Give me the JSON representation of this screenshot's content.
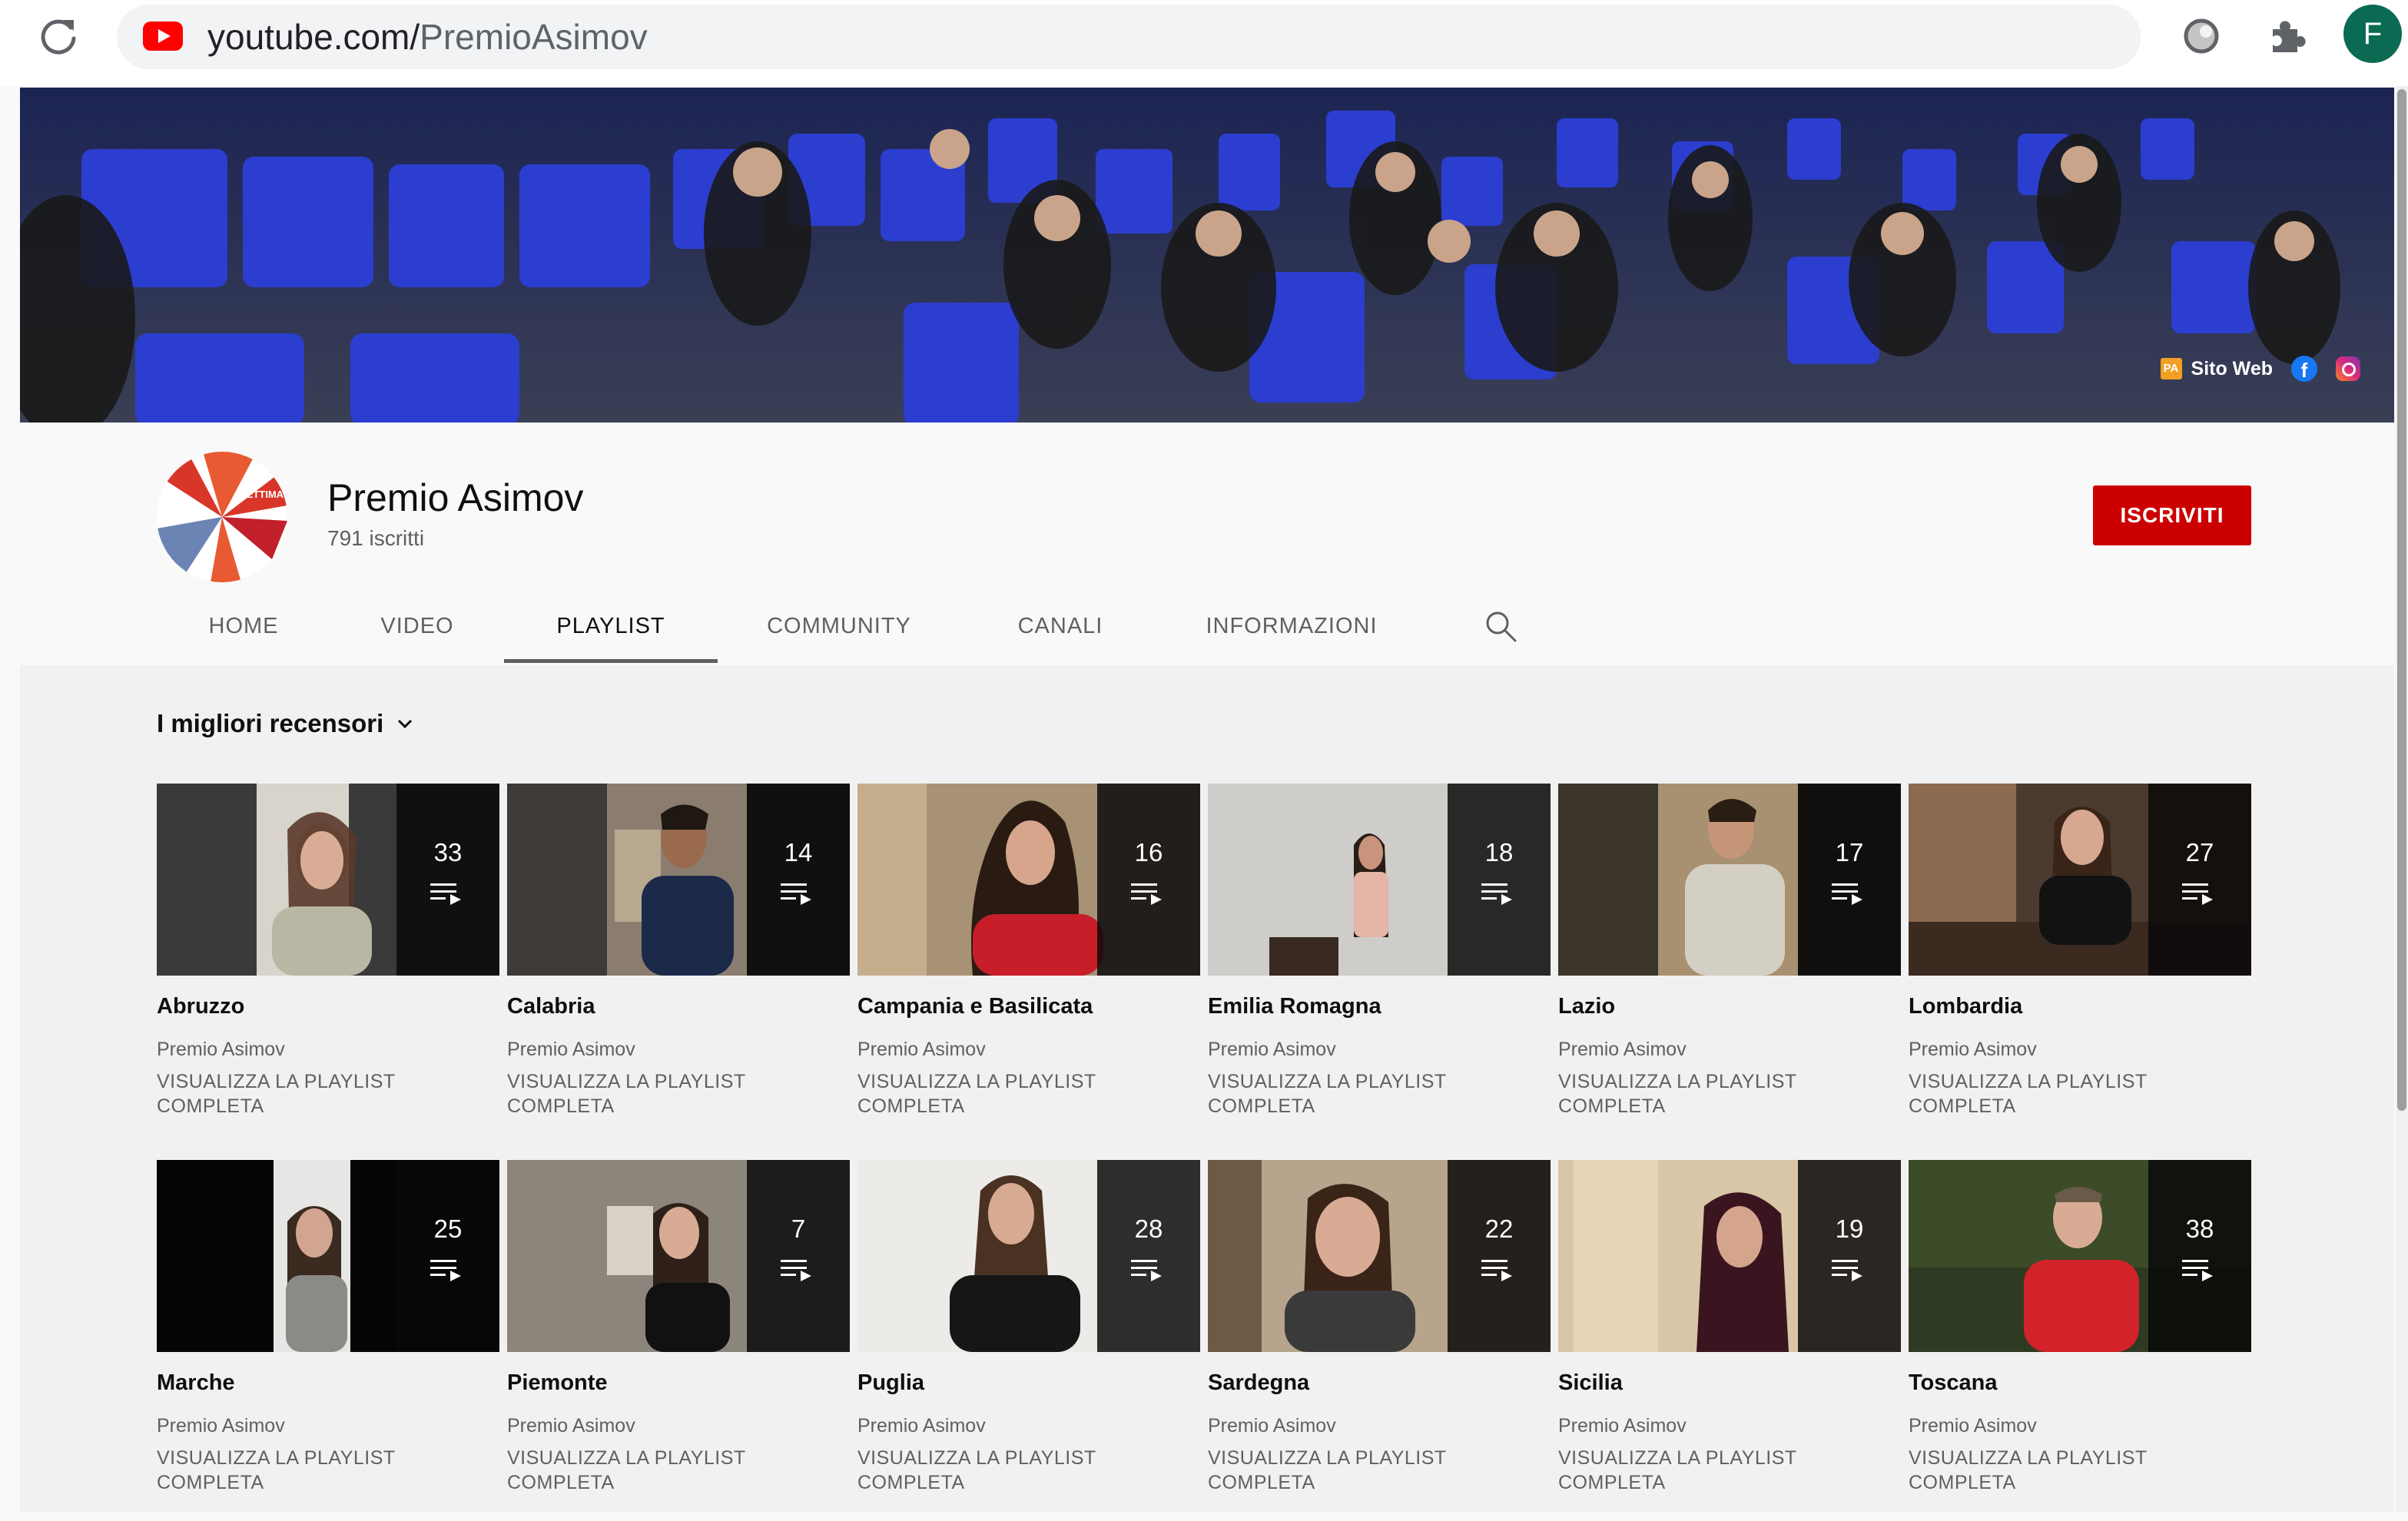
{
  "browser": {
    "url_host": "youtube.com/",
    "url_path": "PremioAsimov",
    "profile_initial": "F",
    "icons": [
      "reload-icon",
      "youtube-favicon",
      "extension-circle-icon",
      "puzzle-icon"
    ]
  },
  "banner": {
    "link_label": "Sito Web",
    "link_icon_label": "PA",
    "fb_letter": "f",
    "seat_color": "#2b3ed0"
  },
  "channel": {
    "name": "Premio Asimov",
    "subscribers": "791 iscritti",
    "subscribe_label": "ISCRIVITI",
    "subscribe_color": "#cc0000",
    "avatar_text": "SETTIMA"
  },
  "tabs": [
    {
      "label": "HOME"
    },
    {
      "label": "VIDEO"
    },
    {
      "label": "PLAYLIST",
      "active": true
    },
    {
      "label": "COMMUNITY"
    },
    {
      "label": "CANALI"
    },
    {
      "label": "INFORMAZIONI"
    }
  ],
  "sort_label": "I migliori recensori",
  "playlists": [
    {
      "title": "Abruzzo",
      "owner": "Premio Asimov",
      "count": "33",
      "link": "VISUALIZZA LA PLAYLIST COMPLETA"
    },
    {
      "title": "Calabria",
      "owner": "Premio Asimov",
      "count": "14",
      "link": "VISUALIZZA LA PLAYLIST COMPLETA"
    },
    {
      "title": "Campania e Basilicata",
      "owner": "Premio Asimov",
      "count": "16",
      "link": "VISUALIZZA LA PLAYLIST COMPLETA"
    },
    {
      "title": "Emilia Romagna",
      "owner": "Premio Asimov",
      "count": "18",
      "link": "VISUALIZZA LA PLAYLIST COMPLETA"
    },
    {
      "title": "Lazio",
      "owner": "Premio Asimov",
      "count": "17",
      "link": "VISUALIZZA LA PLAYLIST COMPLETA"
    },
    {
      "title": "Lombardia",
      "owner": "Premio Asimov",
      "count": "27",
      "link": "VISUALIZZA LA PLAYLIST COMPLETA"
    },
    {
      "title": "Marche",
      "owner": "Premio Asimov",
      "count": "25",
      "link": "VISUALIZZA LA PLAYLIST COMPLETA"
    },
    {
      "title": "Piemonte",
      "owner": "Premio Asimov",
      "count": "7",
      "link": "VISUALIZZA LA PLAYLIST COMPLETA"
    },
    {
      "title": "Puglia",
      "owner": "Premio Asimov",
      "count": "28",
      "link": "VISUALIZZA LA PLAYLIST COMPLETA"
    },
    {
      "title": "Sardegna",
      "owner": "Premio Asimov",
      "count": "22",
      "link": "VISUALIZZA LA PLAYLIST COMPLETA"
    },
    {
      "title": "Sicilia",
      "owner": "Premio Asimov",
      "count": "19",
      "link": "VISUALIZZA LA PLAYLIST COMPLETA"
    },
    {
      "title": "Toscana",
      "owner": "Premio Asimov",
      "count": "38",
      "link": "VISUALIZZA LA PLAYLIST COMPLETA"
    }
  ]
}
